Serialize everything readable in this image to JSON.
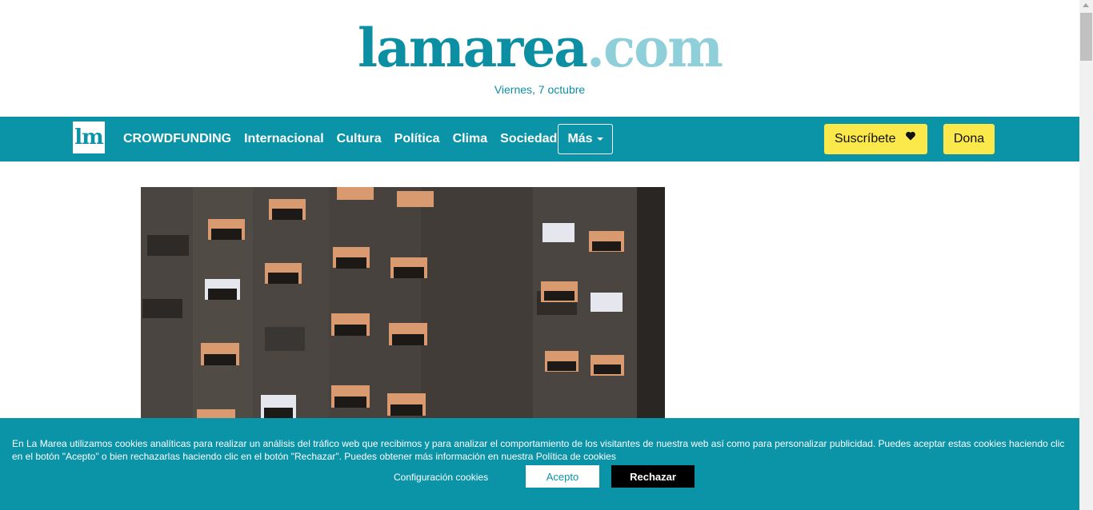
{
  "header": {
    "logo_main": "lamarea",
    "logo_tld": ".com",
    "date": "Viernes, 7 octubre"
  },
  "nav": {
    "logo_text": "lm",
    "items": [
      {
        "label": "CROWDFUNDING"
      },
      {
        "label": "Internacional"
      },
      {
        "label": "Cultura"
      },
      {
        "label": "Política"
      },
      {
        "label": "Clima"
      },
      {
        "label": "Sociedad"
      }
    ],
    "more_label": "Más",
    "subscribe_label": "Suscríbete",
    "donate_label": "Dona"
  },
  "hero": {
    "icons": [
      "building-photo"
    ]
  },
  "cookie_bar": {
    "text": "En La Marea utilizamos cookies analíticas para realizar un análisis del tráfico web que recibimos y para analizar el comportamiento de los visitantes de nuestra web así como para personalizar publicidad. Puedes aceptar estas cookies haciendo clic en el botón \"Acepto\" o bien rechazarlas haciendo clic en el botón \"Rechazar\". Puedes obtener más información en nuestra Política de cookies",
    "config_label": "Configuración cookies",
    "accept_label": "Acepto",
    "reject_label": "Rechazar"
  },
  "colors": {
    "brand": "#0b93a8",
    "brand_light": "#8ecfd9",
    "button_yellow": "#fbe84a"
  }
}
